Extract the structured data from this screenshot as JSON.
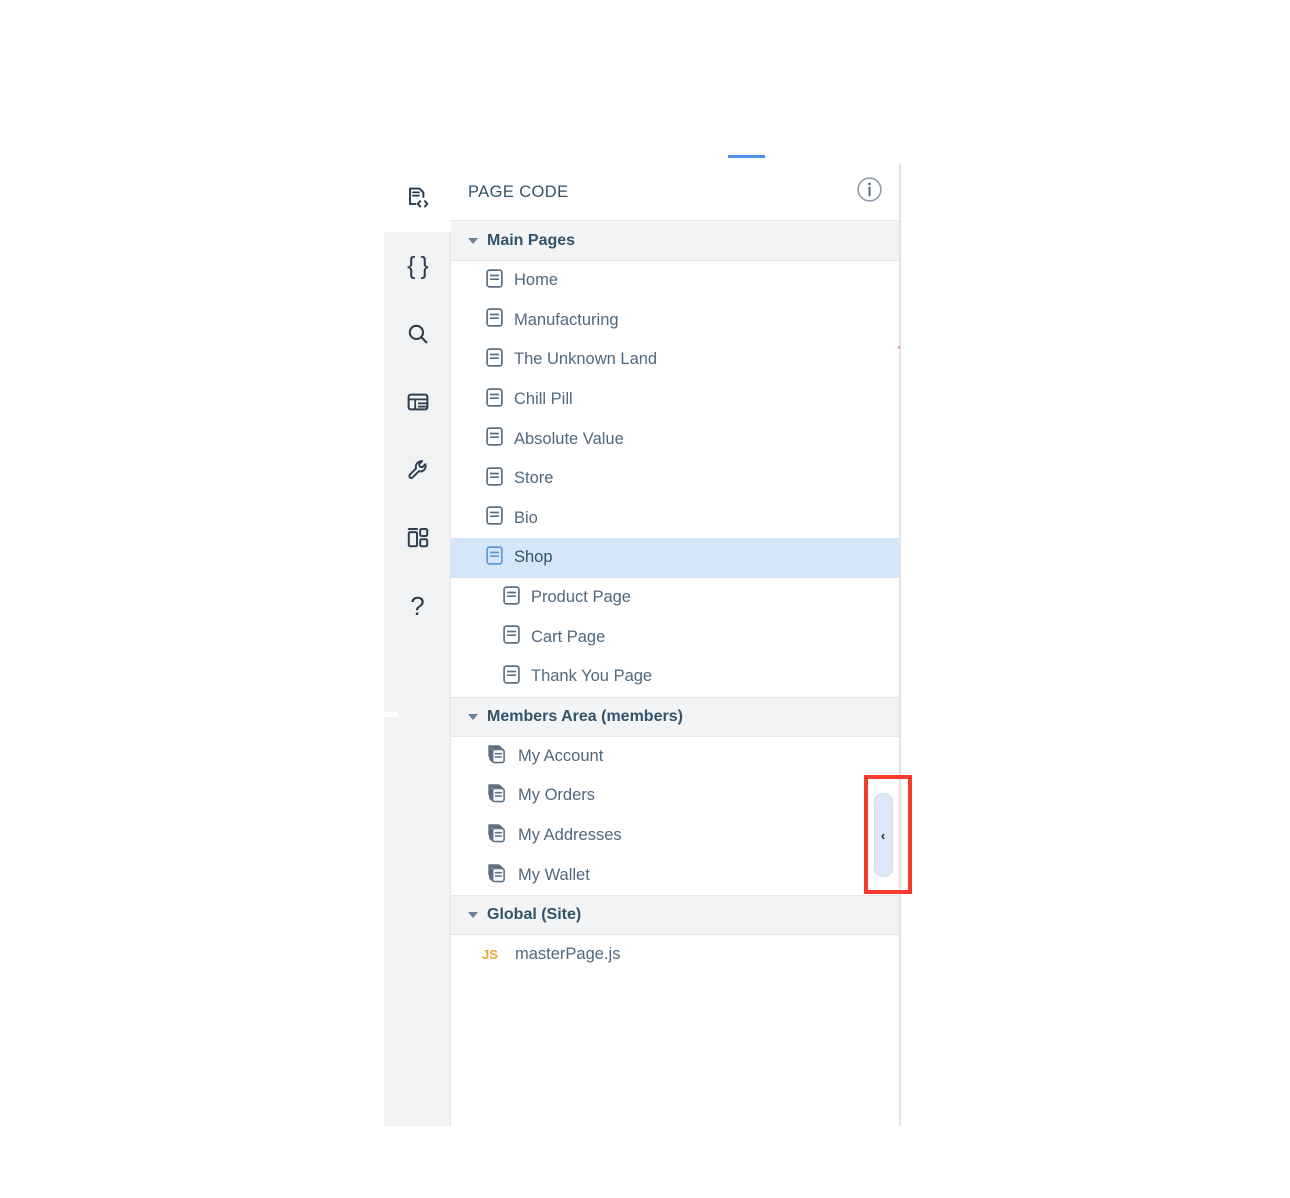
{
  "panel": {
    "title": "PAGE CODE",
    "info_icon": "info-circle-icon",
    "collapse_chevron": "‹",
    "accent_color": "#4a90e8",
    "selected_row_color": "#d4e6f7",
    "annotation_color": "#f43c2b",
    "js_badge_color": "#e8a33d"
  },
  "icon_rail": {
    "items": [
      {
        "name": "page-code-icon",
        "active": true,
        "glyph": ""
      },
      {
        "name": "curly-braces-icon",
        "active": false,
        "glyph": "{ }"
      },
      {
        "name": "search-icon",
        "active": false,
        "glyph": ""
      },
      {
        "name": "database-icon",
        "active": false,
        "glyph": ""
      },
      {
        "name": "wrench-icon",
        "active": false,
        "glyph": ""
      },
      {
        "name": "widgets-icon",
        "active": false,
        "glyph": ""
      },
      {
        "name": "help-icon",
        "active": false,
        "glyph": "?"
      }
    ]
  },
  "tree": {
    "sections": [
      {
        "label": "Main Pages",
        "expanded": true,
        "items": [
          {
            "label": "Home",
            "icon": "page-icon",
            "child": false,
            "selected": false
          },
          {
            "label": "Manufacturing",
            "icon": "page-icon",
            "child": false,
            "selected": false
          },
          {
            "label": "The Unknown Land",
            "icon": "page-icon",
            "child": false,
            "selected": false
          },
          {
            "label": "Chill Pill",
            "icon": "page-icon",
            "child": false,
            "selected": false
          },
          {
            "label": "Absolute Value",
            "icon": "page-icon",
            "child": false,
            "selected": false
          },
          {
            "label": "Store",
            "icon": "page-icon",
            "child": false,
            "selected": false
          },
          {
            "label": "Bio",
            "icon": "page-icon",
            "child": false,
            "selected": false
          },
          {
            "label": "Shop",
            "icon": "page-icon",
            "child": false,
            "selected": true
          },
          {
            "label": "Product Page",
            "icon": "page-icon",
            "child": true,
            "selected": false
          },
          {
            "label": "Cart Page",
            "icon": "page-icon",
            "child": true,
            "selected": false
          },
          {
            "label": "Thank You Page",
            "icon": "page-icon",
            "child": true,
            "selected": false
          }
        ]
      },
      {
        "label": "Members Area (members)",
        "expanded": true,
        "items": [
          {
            "label": "My Account",
            "icon": "stacked-pages-icon",
            "child": false,
            "selected": false
          },
          {
            "label": "My Orders",
            "icon": "stacked-pages-icon",
            "child": false,
            "selected": false
          },
          {
            "label": "My Addresses",
            "icon": "stacked-pages-icon",
            "child": false,
            "selected": false
          },
          {
            "label": "My Wallet",
            "icon": "stacked-pages-icon",
            "child": false,
            "selected": false
          }
        ]
      },
      {
        "label": "Global (Site)",
        "expanded": true,
        "items": [
          {
            "label": "masterPage.js",
            "icon": "js-file-icon",
            "badge": "JS",
            "child": false,
            "selected": false
          }
        ]
      }
    ]
  }
}
